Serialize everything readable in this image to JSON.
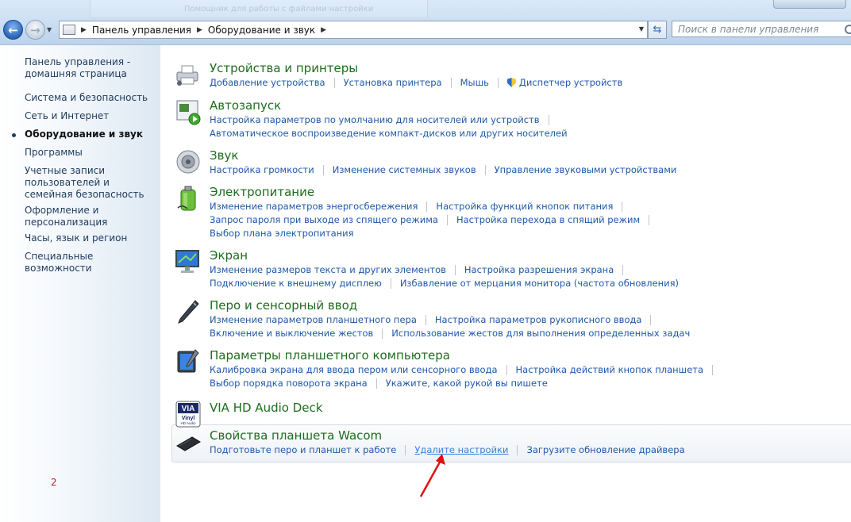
{
  "window": {
    "ghost_title": "Помощник для работы с файлами настройки планшета"
  },
  "address_bar": {
    "crumbs": [
      "Панель управления",
      "Оборудование и звук"
    ]
  },
  "search": {
    "placeholder": "Поиск в панели управления"
  },
  "sidebar": {
    "items": [
      {
        "label": "Панель управления - домашняя страница"
      },
      {
        "label": "Система и безопасность"
      },
      {
        "label": "Сеть и Интернет"
      },
      {
        "label": "Оборудование и звук",
        "current": true
      },
      {
        "label": "Программы"
      },
      {
        "label": "Учетные записи пользователей и семейная безопасность"
      },
      {
        "label": "Оформление и персонализация"
      },
      {
        "label": "Часы, язык и регион"
      },
      {
        "label": "Специальные возможности"
      }
    ]
  },
  "page_number": "2",
  "sections": [
    {
      "title": "Устройства и принтеры",
      "icon": "printer-icon",
      "rows": [
        [
          "Добавление устройства",
          "Установка принтера",
          "Мышь",
          "Диспетчер устройств"
        ]
      ]
    },
    {
      "title": "Автозапуск",
      "icon": "autoplay-icon",
      "rows": [
        [
          "Настройка параметров по умолчанию для носителей или устройств"
        ],
        [
          "Автоматическое воспроизведение компакт-дисков или других носителей"
        ]
      ]
    },
    {
      "title": "Звук",
      "icon": "speaker-icon",
      "rows": [
        [
          "Настройка громкости",
          "Изменение системных звуков",
          "Управление звуковыми устройствами"
        ]
      ]
    },
    {
      "title": "Электропитание",
      "icon": "battery-icon",
      "rows": [
        [
          "Изменение параметров энергосбережения",
          "Настройка функций кнопок питания"
        ],
        [
          "Запрос пароля при выходе из спящего режима",
          "Настройка перехода в спящий режим"
        ],
        [
          "Выбор плана электропитания"
        ]
      ]
    },
    {
      "title": "Экран",
      "icon": "monitor-icon",
      "rows": [
        [
          "Изменение размеров текста и других элементов",
          "Настройка разрешения экрана"
        ],
        [
          "Подключение к внешнему дисплею",
          "Избавление от мерцания монитора (частота обновления)"
        ]
      ]
    },
    {
      "title": "Перо и сенсорный ввод",
      "icon": "pen-icon",
      "rows": [
        [
          "Изменение параметров планшетного пера",
          "Настройка параметров рукописного ввода"
        ],
        [
          "Включение и выключение жестов",
          "Использование жестов для выполнения определенных задач"
        ]
      ]
    },
    {
      "title": "Параметры планшетного компьютера",
      "icon": "tablet-icon",
      "rows": [
        [
          "Калибровка экрана для ввода пером или сенсорного ввода",
          "Настройка действий кнопок планшета"
        ],
        [
          "Выбор порядка поворота экрана",
          "Укажите, какой рукой вы пишете"
        ]
      ]
    },
    {
      "title": "VIA HD Audio Deck",
      "icon": "via-vinyl-icon",
      "icon_text": [
        "VIA",
        "Vinyl",
        "HD Audio"
      ],
      "rows": []
    },
    {
      "title": "Свойства планшета Wacom",
      "icon": "wacom-tablet-icon",
      "rows": [
        [
          "Подготовьте перо и планшет к работе",
          "Удалите настройки",
          "Загрузите обновление драйвера"
        ]
      ]
    }
  ],
  "colors": {
    "section_title": "#1d6d1d",
    "link": "#1f58a8",
    "annotation_arrow": "#e01010"
  }
}
